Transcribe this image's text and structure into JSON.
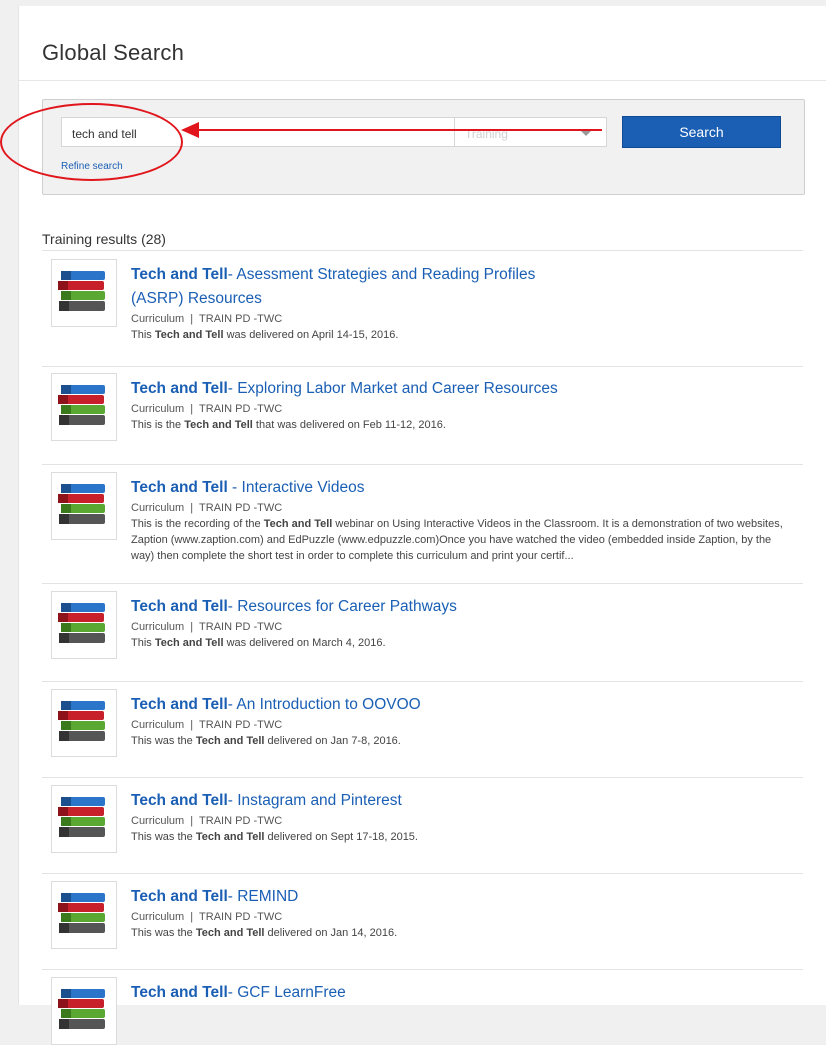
{
  "page": {
    "title": "Global Search"
  },
  "search": {
    "query": "tech and tell",
    "type_placeholder": "Training",
    "button_label": "Search",
    "refine_label": "Refine search"
  },
  "results": {
    "heading": "Training results (28)",
    "items": [
      {
        "title_bold": "Tech and Tell",
        "title_rest": "- Asessment Strategies and Reading Profiles (ASRP) Resources",
        "meta": "Curriculum  |  TRAIN PD -TWC",
        "desc_pre": "This ",
        "desc_bold": "Tech and Tell",
        "desc_post": " was delivered on April 14-15, 2016."
      },
      {
        "title_bold": "Tech and Tell",
        "title_rest": "- Exploring Labor Market and Career Resources",
        "meta": "Curriculum  |  TRAIN PD -TWC",
        "desc_pre": "This is the ",
        "desc_bold": "Tech and Tell",
        "desc_post": " that was delivered on Feb 11-12, 2016."
      },
      {
        "title_bold": "Tech and Tell",
        "title_rest": " - Interactive Videos",
        "meta": "Curriculum  |  TRAIN PD -TWC",
        "desc_pre": "This is the recording of the ",
        "desc_bold": "Tech and Tell",
        "desc_post": " webinar on Using Interactive Videos in the Classroom. It is a demonstration of two websites, Zaption (www.zaption.com) and EdPuzzle (www.edpuzzle.com)Once you have watched the video (embedded inside Zaption, by the way) then complete the short test in order to complete this curriculum and print your certif..."
      },
      {
        "title_bold": "Tech and Tell",
        "title_rest": "- Resources for Career Pathways",
        "meta": "Curriculum  |  TRAIN PD -TWC",
        "desc_pre": "This ",
        "desc_bold": "Tech and Tell",
        "desc_post": " was delivered on March 4, 2016."
      },
      {
        "title_bold": "Tech and Tell",
        "title_rest": "- An Introduction to OOVOO",
        "meta": "Curriculum  |  TRAIN PD -TWC",
        "desc_pre": "This was the ",
        "desc_bold": "Tech and Tell",
        "desc_post": " delivered on Jan 7-8, 2016."
      },
      {
        "title_bold": "Tech and Tell",
        "title_rest": "- Instagram and Pinterest",
        "meta": "Curriculum  |  TRAIN PD -TWC",
        "desc_pre": "This was the ",
        "desc_bold": "Tech and Tell",
        "desc_post": " delivered on Sept 17-18, 2015."
      },
      {
        "title_bold": "Tech and Tell",
        "title_rest": "- REMIND",
        "meta": "Curriculum  |  TRAIN PD -TWC",
        "desc_pre": "This was the ",
        "desc_bold": "Tech and Tell",
        "desc_post": " delivered on Jan 14, 2016."
      },
      {
        "title_bold": "Tech and Tell",
        "title_rest": "- GCF LearnFree"
      }
    ]
  },
  "icons": {
    "result_thumbnail": "books-icon",
    "annotation_arrow": "arrow-left-icon"
  },
  "colors": {
    "link": "#1a5fb4",
    "button": "#1a5fb4",
    "annotation": "#e0161c"
  }
}
